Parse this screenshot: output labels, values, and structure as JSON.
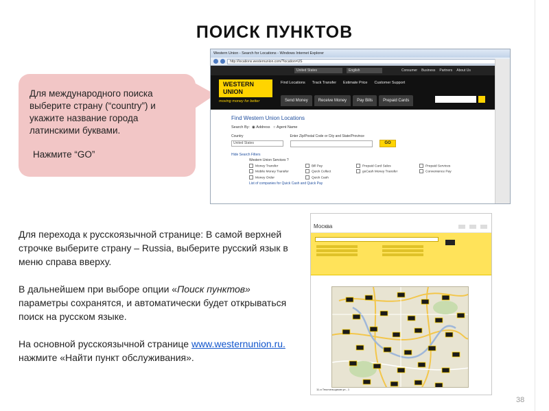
{
  "slide": {
    "title": "ПОИСК ПУНКТОВ",
    "page_number": "38"
  },
  "bubble": {
    "text": "Для международного поиска выберите страну (“country”) и укажите название города латинскими буквами.",
    "go_text": "Нажмите “GO”"
  },
  "instructions": {
    "p1": "Для перехода к русскоязычной странице: В самой верхней строчке выберите страну – Russia, выберите русский язык в меню справа вверху.",
    "p2_prefix": "В дальнейшем при выборе опции «",
    "p2_italic": "Поиск пунктов»",
    "p2_suffix": " параметры сохранятся, и автоматически будет открываться поиск на русском языке.",
    "p3_prefix": "На основной русскоязычной странице ",
    "p3_link": "www.westernunion.ru.",
    "p3_suffix": " нажмите «Найти пункт обслуживания»."
  },
  "screenshot1": {
    "window_title": "Western Union - Search for Locations - Windows Internet Explorer",
    "url": "http://locations.westernunion.com/?location=US",
    "country_select": "United States",
    "language_select": "English",
    "top_links": [
      "Consumer",
      "Business",
      "Partners",
      "About Us"
    ],
    "logo_text": "WESTERN UNION",
    "slogan": "moving money for better",
    "menu": [
      "Find Locations",
      "Track Transfer",
      "Estimate Price",
      "Customer Support"
    ],
    "tabs": [
      "Send Money",
      "Receive Money",
      "Pay Bills",
      "Prepaid Cards"
    ],
    "form_title": "Find Western Union Locations",
    "search_by_label": "Search By:",
    "search_by_options": [
      "Address",
      "Agent Name"
    ],
    "country_label": "Country",
    "zip_label": "Enter Zip/Postal Code or City and State/Province",
    "country_value": "United States",
    "go_button": "GO",
    "hide_filters": "Hide Search Filters",
    "services_title": "Western Union Services ?",
    "services": [
      "Money Transfer",
      "Bill Pay",
      "Prepaid Card Sales",
      "Prepaid Services",
      "Mobile Money Transfer",
      "Quick Collect",
      "goCash Money Transfer",
      "Convenience Pay",
      "Money Order",
      "Quick Cash",
      "",
      ""
    ],
    "services_link": "List of companies for Quick Cash and Quick Pay"
  },
  "screenshot2": {
    "heading": "Москва",
    "footer_text": "11-я Текстильщиков ул., 1"
  },
  "colors": {
    "bubble": "#f2c6c6",
    "wu_yellow": "#ffd400",
    "wu_black": "#111111",
    "link_blue": "#1155cc",
    "map_marker": "#1a1a1a"
  }
}
